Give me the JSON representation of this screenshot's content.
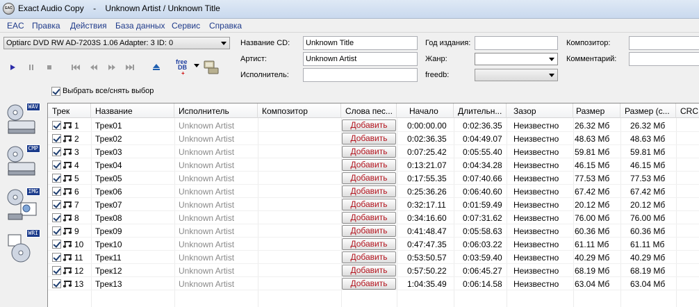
{
  "window": {
    "app_name": "Exact Audio Copy",
    "separator": "-",
    "document_title": "Unknown Artist / Unknown Title",
    "icon_label": "EAC"
  },
  "menu": {
    "items": [
      {
        "label": "EAC"
      },
      {
        "label": "Правка"
      },
      {
        "label": "Действия"
      },
      {
        "label": "База данных"
      },
      {
        "label": "Сервис"
      },
      {
        "label": "Справка"
      }
    ]
  },
  "drive": {
    "selected": "Optiarc DVD RW AD-7203S 1.06   Adapter: 3  ID: 0"
  },
  "cd_info": {
    "cd_title_label": "Название CD:",
    "cd_title_value": "Unknown Title",
    "artist_label": "Артист:",
    "artist_value": "Unknown Artist",
    "performer_label": "Исполнитель:",
    "performer_value": "",
    "year_label": "Год издания:",
    "year_value": "",
    "genre_label": "Жанр:",
    "genre_value": "",
    "freedb_label": "freedb:",
    "freedb_value": "",
    "composer_label": "Композитор:",
    "composer_value": "",
    "comment_label": "Комментарий:",
    "comment_value": ""
  },
  "toolbar": {
    "buttons": [
      {
        "icon": "play-icon"
      },
      {
        "icon": "pause-icon"
      },
      {
        "icon": "stop-icon"
      },
      {
        "icon": "previous-track-icon"
      },
      {
        "icon": "rewind-icon"
      },
      {
        "icon": "fast-forward-icon"
      },
      {
        "icon": "next-track-icon"
      },
      {
        "icon": "eject-icon"
      },
      {
        "icon": "freedb-icon"
      },
      {
        "icon": "network-icon"
      }
    ],
    "freedb_text_top": "free",
    "freedb_text_bottom": "DB"
  },
  "select_all": {
    "label": "Выбрать все/снять выбор",
    "checked": true
  },
  "sidebar": {
    "items": [
      {
        "tag": "WAV",
        "icon": "copy-to-wav-icon"
      },
      {
        "tag": "CMP",
        "icon": "copy-compress-icon"
      },
      {
        "tag": "IMG",
        "icon": "copy-image-icon"
      },
      {
        "tag": "WRI",
        "icon": "write-cd-icon"
      }
    ]
  },
  "table": {
    "columns": [
      "Трек",
      "Название",
      "Исполнитель",
      "Композитор",
      "Слова пес...",
      "Начало",
      "Длительн...",
      "Зазор",
      "Размер",
      "Размер (с...",
      "CRC:"
    ],
    "rows": [
      {
        "track": "1",
        "title": "Трек01",
        "artist": "Unknown Artist",
        "composer": "",
        "lyrics": "Добавить",
        "start": "0:00:00.00",
        "length": "0:02:36.35",
        "gap": "Неизвестно",
        "size": "26.32 Мб",
        "size_c": "26.32 Мб",
        "crc": ""
      },
      {
        "track": "2",
        "title": "Трек02",
        "artist": "Unknown Artist",
        "composer": "",
        "lyrics": "Добавить",
        "start": "0:02:36.35",
        "length": "0:04:49.07",
        "gap": "Неизвестно",
        "size": "48.63 Мб",
        "size_c": "48.63 Мб",
        "crc": ""
      },
      {
        "track": "3",
        "title": "Трек03",
        "artist": "Unknown Artist",
        "composer": "",
        "lyrics": "Добавить",
        "start": "0:07:25.42",
        "length": "0:05:55.40",
        "gap": "Неизвестно",
        "size": "59.81 Мб",
        "size_c": "59.81 Мб",
        "crc": ""
      },
      {
        "track": "4",
        "title": "Трек04",
        "artist": "Unknown Artist",
        "composer": "",
        "lyrics": "Добавить",
        "start": "0:13:21.07",
        "length": "0:04:34.28",
        "gap": "Неизвестно",
        "size": "46.15 Мб",
        "size_c": "46.15 Мб",
        "crc": ""
      },
      {
        "track": "5",
        "title": "Трек05",
        "artist": "Unknown Artist",
        "composer": "",
        "lyrics": "Добавить",
        "start": "0:17:55.35",
        "length": "0:07:40.66",
        "gap": "Неизвестно",
        "size": "77.53 Мб",
        "size_c": "77.53 Мб",
        "crc": ""
      },
      {
        "track": "6",
        "title": "Трек06",
        "artist": "Unknown Artist",
        "composer": "",
        "lyrics": "Добавить",
        "start": "0:25:36.26",
        "length": "0:06:40.60",
        "gap": "Неизвестно",
        "size": "67.42 Мб",
        "size_c": "67.42 Мб",
        "crc": ""
      },
      {
        "track": "7",
        "title": "Трек07",
        "artist": "Unknown Artist",
        "composer": "",
        "lyrics": "Добавить",
        "start": "0:32:17.11",
        "length": "0:01:59.49",
        "gap": "Неизвестно",
        "size": "20.12 Мб",
        "size_c": "20.12 Мб",
        "crc": ""
      },
      {
        "track": "8",
        "title": "Трек08",
        "artist": "Unknown Artist",
        "composer": "",
        "lyrics": "Добавить",
        "start": "0:34:16.60",
        "length": "0:07:31.62",
        "gap": "Неизвестно",
        "size": "76.00 Мб",
        "size_c": "76.00 Мб",
        "crc": ""
      },
      {
        "track": "9",
        "title": "Трек09",
        "artist": "Unknown Artist",
        "composer": "",
        "lyrics": "Добавить",
        "start": "0:41:48.47",
        "length": "0:05:58.63",
        "gap": "Неизвестно",
        "size": "60.36 Мб",
        "size_c": "60.36 Мб",
        "crc": ""
      },
      {
        "track": "10",
        "title": "Трек10",
        "artist": "Unknown Artist",
        "composer": "",
        "lyrics": "Добавить",
        "start": "0:47:47.35",
        "length": "0:06:03.22",
        "gap": "Неизвестно",
        "size": "61.11 Мб",
        "size_c": "61.11 Мб",
        "crc": ""
      },
      {
        "track": "11",
        "title": "Трек11",
        "artist": "Unknown Artist",
        "composer": "",
        "lyrics": "Добавить",
        "start": "0:53:50.57",
        "length": "0:03:59.40",
        "gap": "Неизвестно",
        "size": "40.29 Мб",
        "size_c": "40.29 Мб",
        "crc": ""
      },
      {
        "track": "12",
        "title": "Трек12",
        "artist": "Unknown Artist",
        "composer": "",
        "lyrics": "Добавить",
        "start": "0:57:50.22",
        "length": "0:06:45.27",
        "gap": "Неизвестно",
        "size": "68.19 Мб",
        "size_c": "68.19 Мб",
        "crc": ""
      },
      {
        "track": "13",
        "title": "Трек13",
        "artist": "Unknown Artist",
        "composer": "",
        "lyrics": "Добавить",
        "start": "1:04:35.49",
        "length": "0:06:14.58",
        "gap": "Неизвестно",
        "size": "63.04 Мб",
        "size_c": "63.04 Мб",
        "crc": ""
      }
    ]
  },
  "colors": {
    "menu_text": "#1e3a8a",
    "add_button_text": "#b4141e",
    "artist_gray": "#8a8a8a"
  }
}
